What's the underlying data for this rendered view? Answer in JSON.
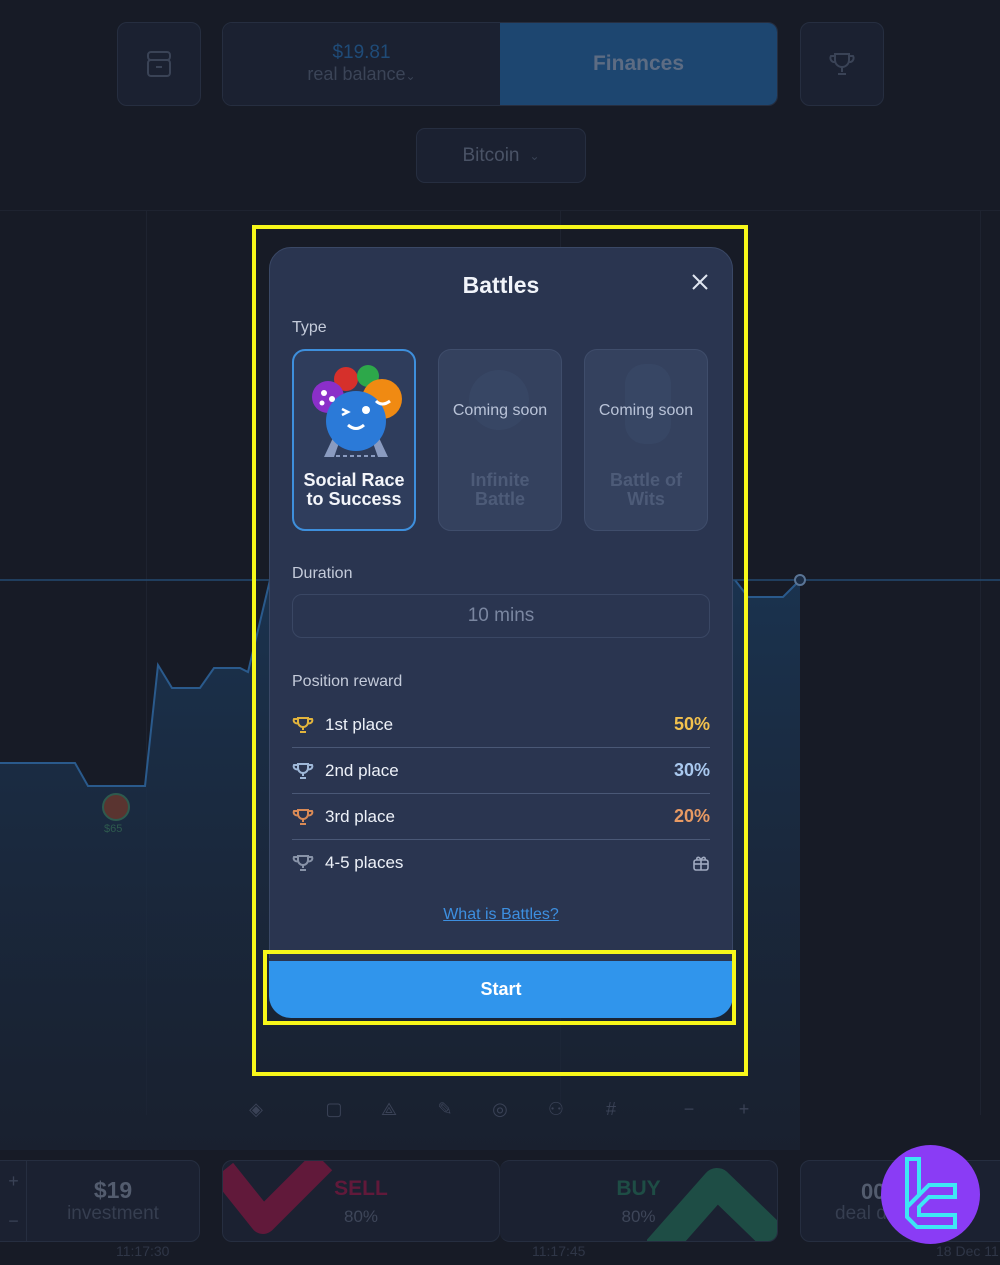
{
  "background_app": {
    "header": {
      "balance_amount": "$19.81",
      "balance_label": "real balance",
      "finances_label": "Finances",
      "asset_selector": "Bitcoin"
    },
    "chart": {
      "marker_label": "$65",
      "time_labels": [
        "11:17:30",
        "11:17:45",
        "18 Dec 11"
      ]
    },
    "bottom": {
      "investment_value": "$19",
      "investment_label": "investment",
      "sell_label": "SELL",
      "sell_payout": "80%",
      "buy_label": "BUY",
      "buy_payout": "80%",
      "deal_value": "00",
      "deal_label": "deal d"
    },
    "colors": {
      "sell": "#61193a",
      "buy": "#1e4d45",
      "accent": "#1d4670"
    }
  },
  "modal": {
    "title": "Battles",
    "type_label": "Type",
    "types": [
      {
        "name": "Social Race to Success",
        "name_line1": "Social Race",
        "name_line2": "to Success",
        "status": "selected"
      },
      {
        "name": "Infinite Battle",
        "name_line1": "Infinite",
        "name_line2": "Battle",
        "status": "Coming soon"
      },
      {
        "name": "Battle of Wits",
        "name_line1": "Battle of",
        "name_line2": "Wits",
        "status": "Coming soon"
      }
    ],
    "duration_label": "Duration",
    "duration_value": "10 mins",
    "position_reward_label": "Position reward",
    "rewards": [
      {
        "place": "1st place",
        "value": "50%",
        "icon": "trophy-gold-icon",
        "color": "#f2c14e"
      },
      {
        "place": "2nd place",
        "value": "30%",
        "icon": "trophy-silver-icon",
        "color": "#a9c8ee"
      },
      {
        "place": "3rd place",
        "value": "20%",
        "icon": "trophy-bronze-icon",
        "color": "#e89a63"
      },
      {
        "place": "4-5 places",
        "value": "",
        "icon": "trophy-grey-icon",
        "color": "#8893a8",
        "reward_icon": "gift-icon"
      }
    ],
    "help_link": "What is Battles?",
    "start_label": "Start"
  },
  "annotations": {
    "highlight_color": "#f7f71a"
  }
}
